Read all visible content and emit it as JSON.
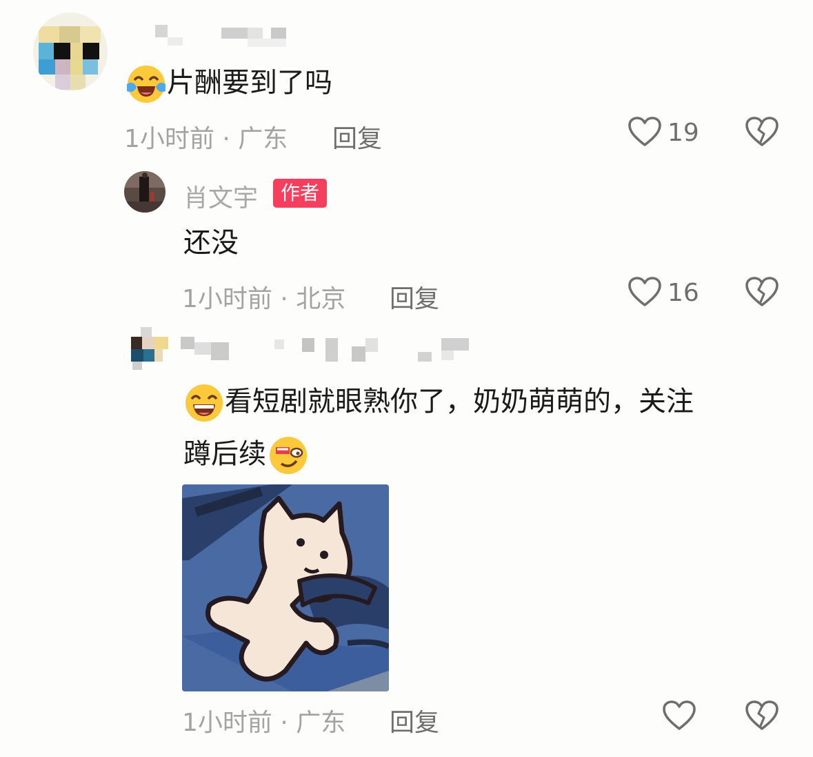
{
  "comments": [
    {
      "username": "",
      "text": "片酬要到了吗",
      "time": "1小时前",
      "location": "广东",
      "reply_label": "回复",
      "likes": "19",
      "emoji_before": "crying-laughing-emoji"
    },
    {
      "username": "肖文宇",
      "badge": "作者",
      "text": "还没",
      "time": "1小时前",
      "location": "北京",
      "reply_label": "回复",
      "likes": "16"
    },
    {
      "username": "",
      "text_line1": "看短剧就眼熟你了，奶奶萌萌的，关注",
      "text_line2": "蹲后续",
      "time": "1小时前",
      "location": "广东",
      "reply_label": "回复",
      "emoji_before": "grinning-emoji",
      "emoji_after": "sly-smile-emoji",
      "sticker": "white-cat-sticker"
    }
  ],
  "separator": "·",
  "colors": {
    "badge": "#f43f5e",
    "meta": "#a3a3a3",
    "icon": "#6e6e6e"
  }
}
